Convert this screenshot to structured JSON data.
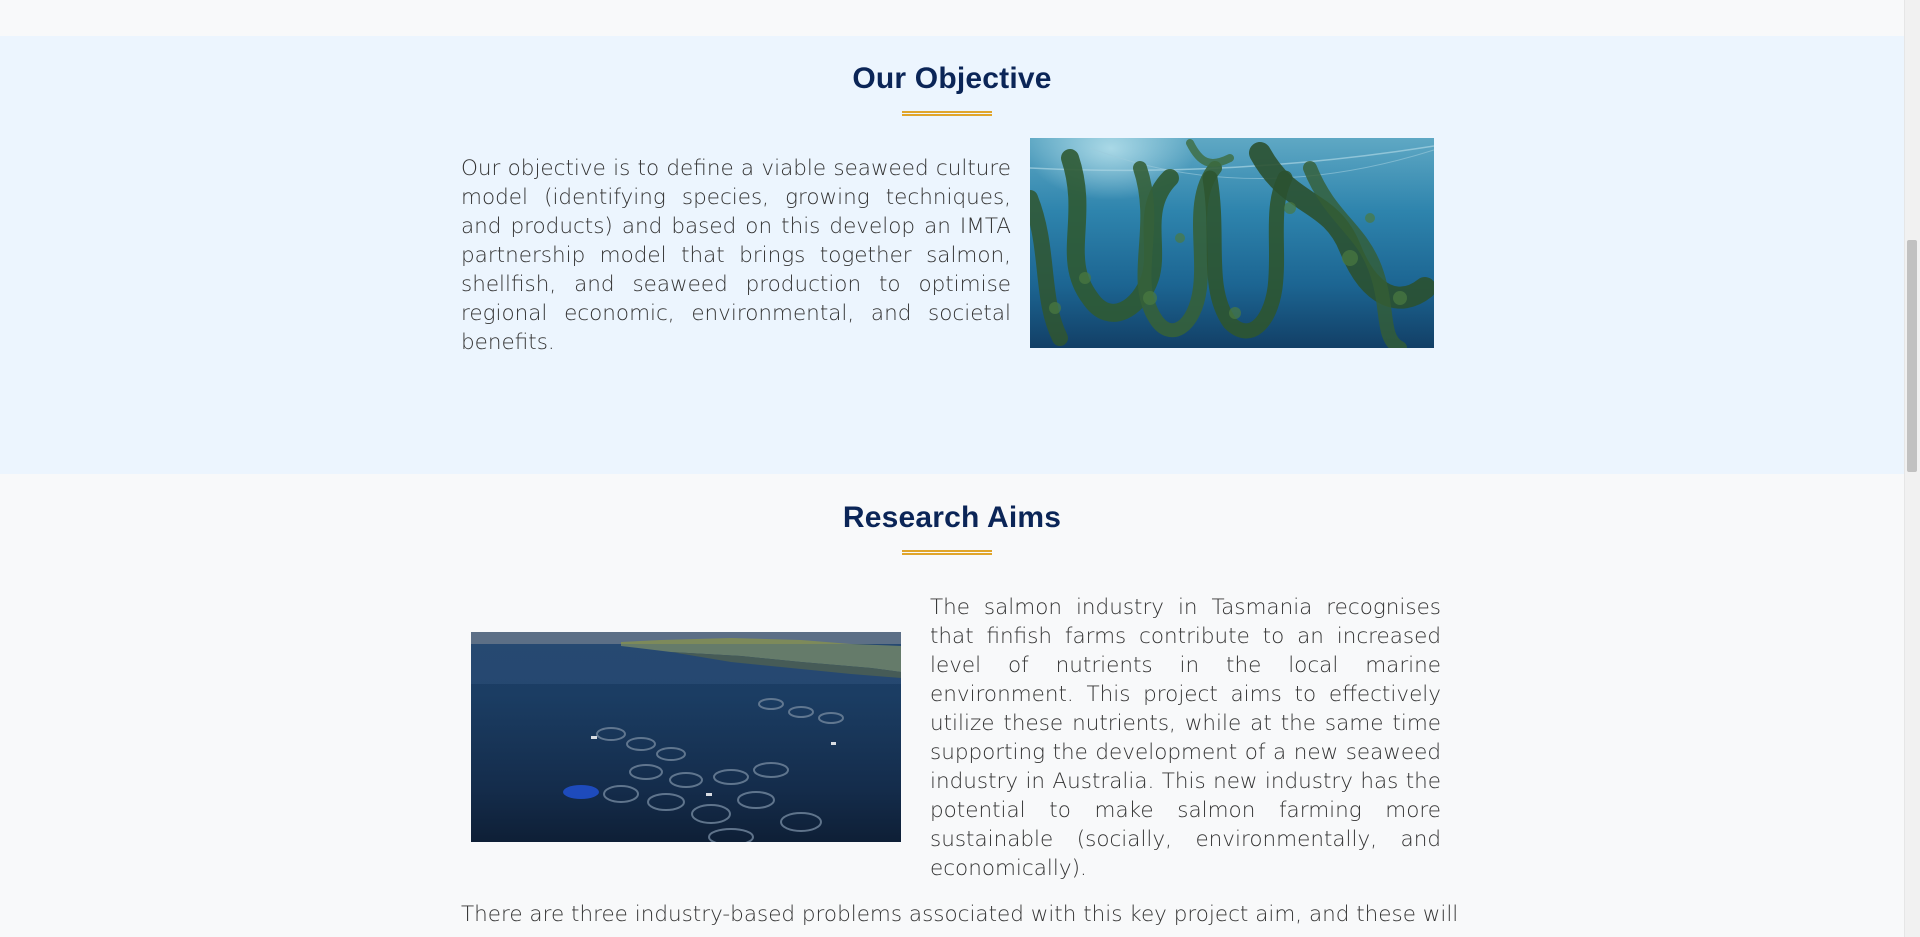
{
  "objective": {
    "title": "Our Objective",
    "text": "Our objective is to define a viable seaweed culture model (identifying species, growing techniques, and products) and based on this develop an IMTA partnership model that brings together salmon, shellfish, and seaweed production to optimise regional economic, environmental, and societal benefits."
  },
  "research": {
    "title": "Research Aims",
    "text": "The salmon industry in Tasmania recognises that finfish farms contribute to an increased level of nutrients in the local marine environment. This project aims to effectively utilize these nutrients, while at the same time supporting the development of a new seaweed industry in Australia. This new industry has the potential to make salmon farming more sustainable (socially, environmentally, and economically).",
    "footer_text": "There are three industry-based problems associated with this key project aim, and these will"
  },
  "colors": {
    "title": "#0b2557",
    "accent": "#e0a52b",
    "objective_bg": "#ecf5fe",
    "page_bg": "#f8f9fa"
  }
}
